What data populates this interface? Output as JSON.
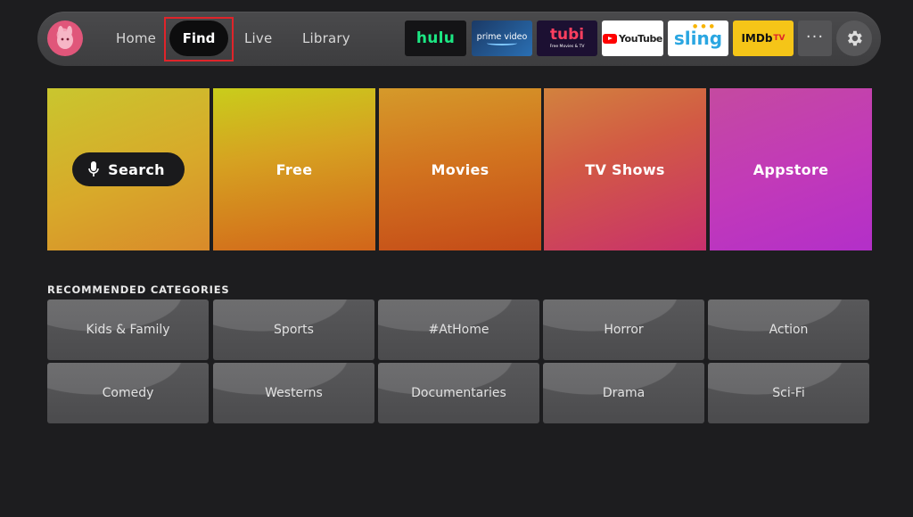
{
  "nav": {
    "home": "Home",
    "find": "Find",
    "live": "Live",
    "library": "Library"
  },
  "apps": {
    "hulu": "hulu",
    "prime": "prime video",
    "tubi": "tubi",
    "tubi_tagline": "Free Movies & TV",
    "youtube": "YouTube",
    "sling": "sling",
    "imdb": "IMDb",
    "imdb_suffix": "TV"
  },
  "more_label": "···",
  "hero": {
    "search": "Search",
    "free": "Free",
    "movies": "Movies",
    "tvshows": "TV Shows",
    "appstore": "Appstore"
  },
  "categories": {
    "heading": "RECOMMENDED CATEGORIES",
    "items": [
      "Kids & Family",
      "Sports",
      "#AtHome",
      "Horror",
      "Action",
      "Comedy",
      "Westerns",
      "Documentaries",
      "Drama",
      "Sci-Fi"
    ]
  },
  "colors": {
    "highlight": "#e0242a",
    "hulu_green": "#1ce783",
    "imdb_yellow": "#f5c518",
    "youtube_red": "#ff0000"
  }
}
